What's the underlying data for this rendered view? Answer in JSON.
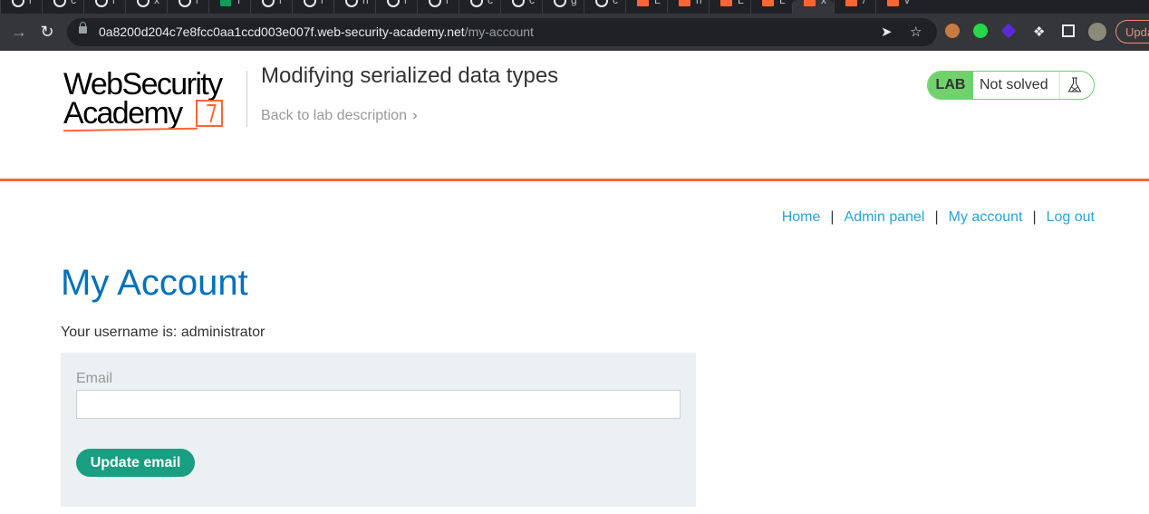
{
  "browser": {
    "url_host": "0a8200d204c7e8fcc0aa1ccd003e007f.web-security-academy.net",
    "url_path": "/my-account",
    "update_label": "Upda",
    "tabs": [
      {
        "icon": "spiral-icon",
        "glyph": "r"
      },
      {
        "icon": "spiral-icon",
        "glyph": "c"
      },
      {
        "icon": "spiral-icon",
        "glyph": "r"
      },
      {
        "icon": "spiral-icon",
        "glyph": "x"
      },
      {
        "icon": "spiral-icon",
        "glyph": "r"
      },
      {
        "icon": "sheets-icon",
        "glyph": "f"
      },
      {
        "icon": "spiral-icon",
        "glyph": "r"
      },
      {
        "icon": "spiral-icon",
        "glyph": "r"
      },
      {
        "icon": "spiral-icon",
        "glyph": "n"
      },
      {
        "icon": "spiral-icon",
        "glyph": "r"
      },
      {
        "icon": "spiral-icon",
        "glyph": "r"
      },
      {
        "icon": "spiral-icon",
        "glyph": "c"
      },
      {
        "icon": "spiral-icon",
        "glyph": "c"
      },
      {
        "icon": "spiral-icon",
        "glyph": "g"
      },
      {
        "icon": "spiral-icon",
        "glyph": "c"
      },
      {
        "icon": "portswigger-icon",
        "glyph": "L"
      },
      {
        "icon": "portswigger-icon",
        "glyph": "n"
      },
      {
        "icon": "portswigger-icon",
        "glyph": "L"
      },
      {
        "icon": "portswigger-icon",
        "glyph": "L"
      },
      {
        "icon": "portswigger-icon",
        "glyph": "x"
      },
      {
        "icon": "portswigger-icon",
        "glyph": "/"
      },
      {
        "icon": "portswigger-icon",
        "glyph": "v"
      }
    ]
  },
  "header": {
    "logo_line1": "WebSecurity",
    "logo_line2": "Academy",
    "lab_title": "Modifying serialized data types",
    "back_link": "Back to lab description",
    "status_badge": "LAB",
    "status_text": "Not solved"
  },
  "nav": {
    "home": "Home",
    "admin": "Admin panel",
    "account": "My account",
    "logout": "Log out",
    "separator": "|"
  },
  "main": {
    "title": "My Account",
    "username_text": "Your username is: administrator",
    "email_label": "Email",
    "email_value": "",
    "update_button": "Update email"
  },
  "colors": {
    "brand_orange": "#ff6633",
    "link_blue": "#29a3d9",
    "heading_blue": "#0071bc",
    "lab_green": "#70d16d",
    "button_teal": "#1a9e81",
    "form_bg": "#ebf0f2"
  }
}
